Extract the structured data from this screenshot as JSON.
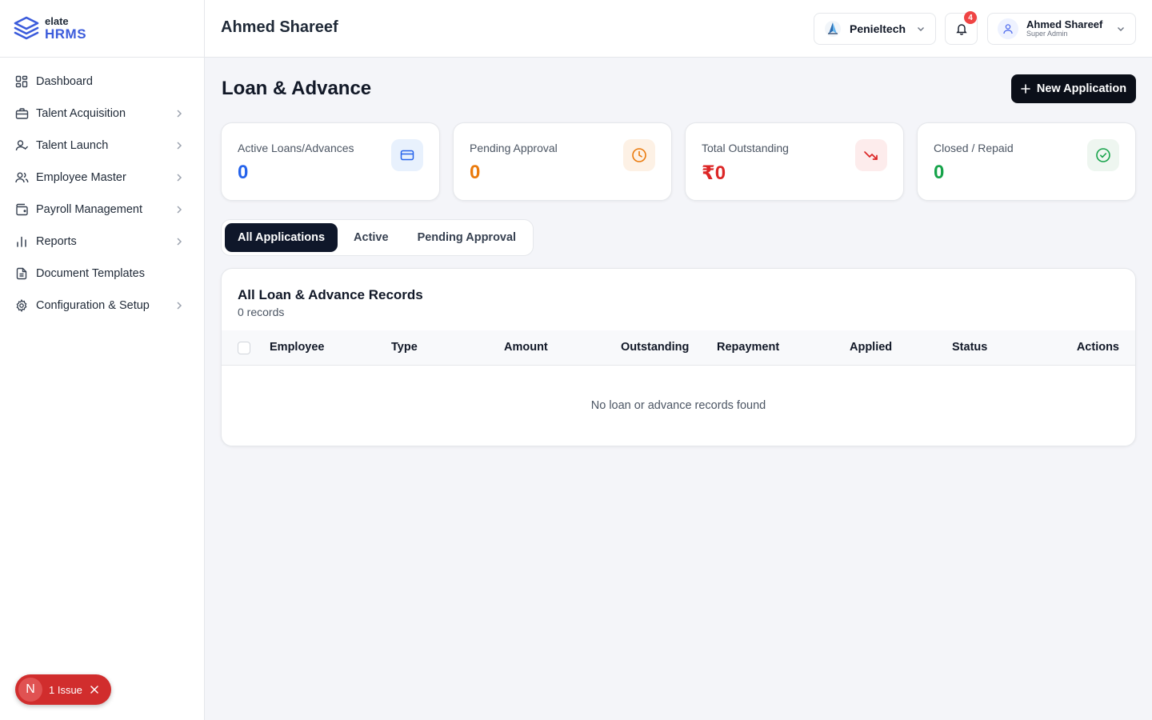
{
  "brand": {
    "top": "elate",
    "bottom": "HRMS"
  },
  "sidebar": {
    "items": [
      {
        "label": "Dashboard",
        "icon": "dashboard-icon",
        "chevron": false
      },
      {
        "label": "Talent Acquisition",
        "icon": "briefcase-icon",
        "chevron": true
      },
      {
        "label": "Talent Launch",
        "icon": "user-check-icon",
        "chevron": true
      },
      {
        "label": "Employee Master",
        "icon": "users-icon",
        "chevron": true
      },
      {
        "label": "Payroll Management",
        "icon": "wallet-icon",
        "chevron": true
      },
      {
        "label": "Reports",
        "icon": "bar-chart-icon",
        "chevron": true
      },
      {
        "label": "Document Templates",
        "icon": "document-icon",
        "chevron": false
      },
      {
        "label": "Configuration & Setup",
        "icon": "gear-icon",
        "chevron": true
      }
    ]
  },
  "issue": {
    "letter": "N",
    "label": "1 Issue"
  },
  "header": {
    "title": "Ahmed Shareef",
    "company": "Penieltech",
    "notification_count": "4",
    "user_name": "Ahmed Shareef",
    "user_role": "Super Admin"
  },
  "page": {
    "title": "Loan & Advance",
    "new_button": "New Application"
  },
  "stats": [
    {
      "label": "Active Loans/Advances",
      "value": "0",
      "color": "#2563eb",
      "icon": "credit-card-icon"
    },
    {
      "label": "Pending Approval",
      "value": "0",
      "color": "#ea7a0c",
      "icon": "clock-icon"
    },
    {
      "label": "Total Outstanding",
      "value": "₹0",
      "color": "#dc2626",
      "icon": "trending-down-icon"
    },
    {
      "label": "Closed / Repaid",
      "value": "0",
      "color": "#16a34a",
      "icon": "check-circle-icon"
    }
  ],
  "tabs": [
    {
      "label": "All Applications",
      "active": true
    },
    {
      "label": "Active",
      "active": false
    },
    {
      "label": "Pending Approval",
      "active": false
    }
  ],
  "records": {
    "title": "All Loan & Advance Records",
    "count": "0 records",
    "columns": [
      "Employee",
      "Type",
      "Amount",
      "Outstanding",
      "Repayment",
      "Applied",
      "Status",
      "Actions"
    ],
    "empty": "No loan or advance records found"
  }
}
